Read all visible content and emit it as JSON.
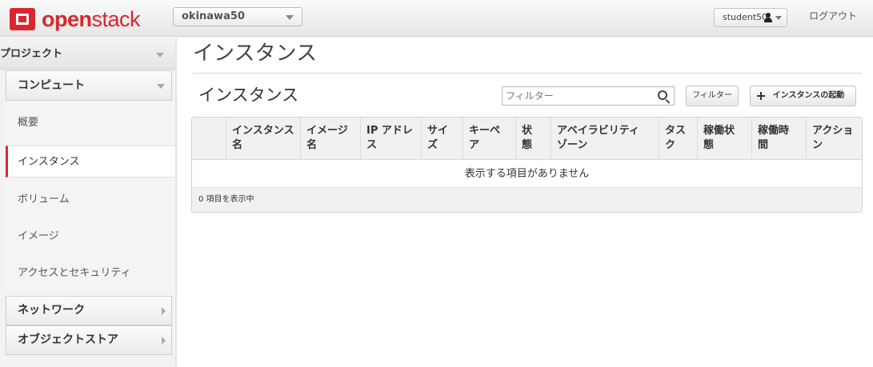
{
  "header": {
    "logo_text_bold": "open",
    "logo_text_light": "stack",
    "project": "okinawa50",
    "user": "student50",
    "logout": "ログアウト"
  },
  "sidebar": {
    "project": "プロジェクト",
    "compute": "コンピュート",
    "items": [
      {
        "label": "概要"
      },
      {
        "label": "インスタンス",
        "active": true
      },
      {
        "label": "ボリューム"
      },
      {
        "label": "イメージ"
      },
      {
        "label": "アクセスとセキュリティ"
      }
    ],
    "network": "ネットワーク",
    "object_store": "オブジェクトストア"
  },
  "main": {
    "page_title": "インスタンス",
    "table_title": "インスタンス",
    "filter_placeholder": "フィルター",
    "filter_button": "フィルター",
    "launch_button": "インスタンスの起動",
    "columns": [
      {
        "line1": "インスタンス",
        "line2": "名"
      },
      {
        "line1": "イメージ",
        "line2": "名"
      },
      {
        "line1": "IP アドレ",
        "line2": "ス"
      },
      {
        "line1": "サイ",
        "line2": "ズ"
      },
      {
        "line1": "キーペ",
        "line2": "ア"
      },
      {
        "line1": "状",
        "line2": "態"
      },
      {
        "line1": "アベイラビリティ",
        "line2": "ゾーン"
      },
      {
        "line1": "タス",
        "line2": "ク"
      },
      {
        "line1": "稼働状",
        "line2": "態"
      },
      {
        "line1": "稼働時",
        "line2": "間"
      },
      {
        "line1": "アクショ",
        "line2": "ン"
      }
    ],
    "empty_message": "表示する項目がありません",
    "footer": "0 項目を表示中"
  },
  "colors": {
    "brand_red": "#d9272e",
    "active_border": "#d9272e"
  }
}
